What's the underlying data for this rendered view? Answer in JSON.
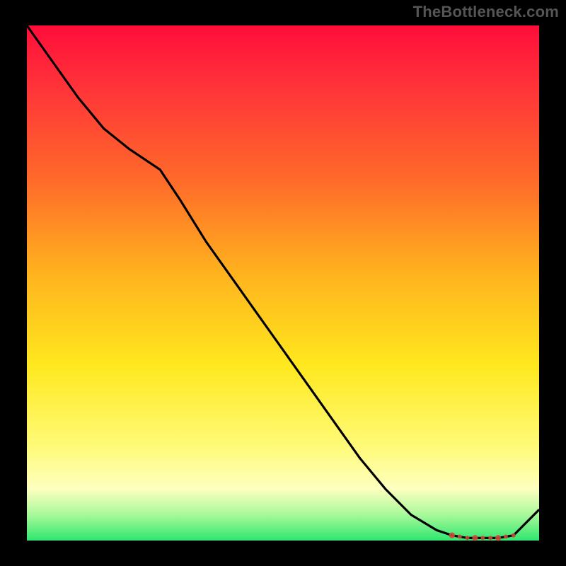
{
  "attribution": "TheBottleneck.com",
  "chart_data": {
    "type": "line",
    "x": [
      0.0,
      0.05,
      0.1,
      0.15,
      0.2,
      0.26,
      0.3,
      0.35,
      0.4,
      0.45,
      0.5,
      0.55,
      0.6,
      0.65,
      0.7,
      0.75,
      0.8,
      0.83,
      0.86,
      0.89,
      0.92,
      0.95,
      1.0
    ],
    "values": [
      1.0,
      0.93,
      0.86,
      0.8,
      0.76,
      0.72,
      0.66,
      0.58,
      0.51,
      0.44,
      0.37,
      0.3,
      0.23,
      0.16,
      0.1,
      0.05,
      0.02,
      0.01,
      0.005,
      0.005,
      0.005,
      0.01,
      0.06
    ],
    "title": "",
    "xlabel": "",
    "ylabel": "",
    "xlim": [
      0,
      1
    ],
    "ylim": [
      0,
      1
    ],
    "optimal_band": {
      "x_start": 0.83,
      "x_end": 0.95
    },
    "annotations": []
  },
  "colors": {
    "curve": "#000000",
    "marker": "#cc4a3a",
    "frame_bg": "#000000"
  }
}
